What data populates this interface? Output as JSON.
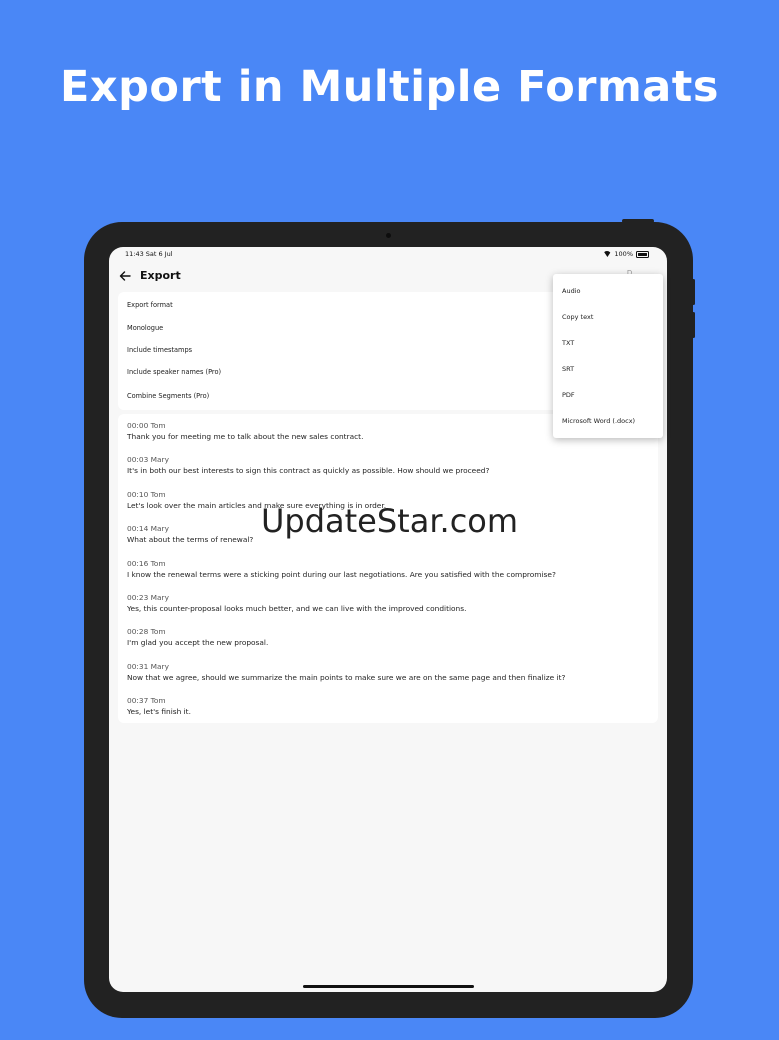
{
  "headline": "Export in Multiple Formats",
  "status_bar": {
    "time": "11:43  Sat 6 Jul",
    "battery": "100%"
  },
  "app_bar": {
    "title": "Export",
    "action": "D..."
  },
  "options": [
    {
      "label": "Export format"
    },
    {
      "label": "Monologue"
    },
    {
      "label": "Include timestamps"
    },
    {
      "label": "Include speaker names (Pro)"
    },
    {
      "label": "Combine Segments (Pro)"
    }
  ],
  "transcript": [
    {
      "header": "00:00 Tom",
      "text": "Thank you for meeting me to talk about the new sales contract."
    },
    {
      "header": "00:03 Mary",
      "text": "It's in both our best interests to sign this contract as quickly as possible. How should we proceed?"
    },
    {
      "header": "00:10 Tom",
      "text": "Let's look over the main articles and make sure everything is in order."
    },
    {
      "header": "00:14 Mary",
      "text": "What about the terms of renewal?"
    },
    {
      "header": "00:16 Tom",
      "text": "I know the renewal terms were a sticking point during our last negotiations. Are you satisfied with the compromise?"
    },
    {
      "header": "00:23 Mary",
      "text": "Yes, this counter-proposal looks much better, and we can live with the improved conditions."
    },
    {
      "header": "00:28 Tom",
      "text": "I'm glad you accept the new proposal."
    },
    {
      "header": "00:31 Mary",
      "text": "Now that we agree, should we summarize the main points to make sure we are on the same page and then finalize it?"
    },
    {
      "header": "00:37 Tom",
      "text": "Yes, let's finish it."
    }
  ],
  "export_menu": {
    "items": [
      "Audio",
      "Copy text",
      "TXT",
      "SRT",
      "PDF",
      "Microsoft Word (.docx)"
    ]
  },
  "watermark": "UpdateStar.com",
  "icons": {
    "back": "arrow-left-icon",
    "wifi": "wifi-icon",
    "battery": "battery-icon"
  },
  "colors": {
    "background": "#4a87f6",
    "device": "#222222",
    "screen": "#f7f7f7"
  }
}
